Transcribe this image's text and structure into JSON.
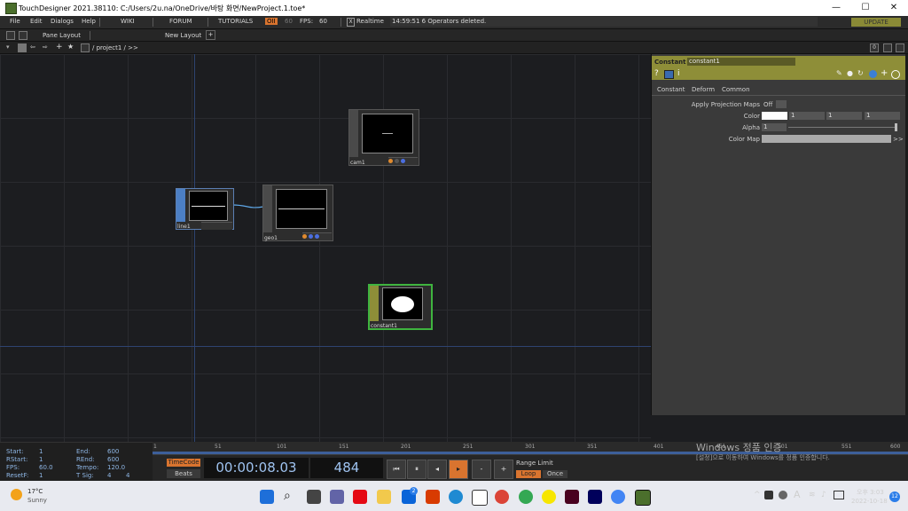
{
  "window": {
    "title": "TouchDesigner 2021.38110: C:/Users/2u.na/OneDrive/바탕 화면/NewProject.1.toe*",
    "minimize": "—",
    "maximize": "☐",
    "close": "✕"
  },
  "menu": {
    "items": [
      "File",
      "Edit",
      "Dialogs",
      "Help"
    ],
    "wiki": "WIKI",
    "forum": "FORUM",
    "tutorials": "TUTORIALS",
    "perf": "OII",
    "fps_target": "60",
    "fps_label": "FPS:",
    "fps_value": "60",
    "realtime_mark": "X",
    "realtime": "Realtime",
    "status": "14:59:51 6 Operators deleted.",
    "update": "UPDATE"
  },
  "panebar": {
    "pane_layout": "Pane Layout",
    "new_layout": "New Layout",
    "add": "+",
    "right_zero": "0"
  },
  "pathbar": {
    "path": "/ project1 / >>"
  },
  "nodes": {
    "cam1": "cam1",
    "line1": "line1",
    "geo1": "geo1",
    "constant1": "constant1"
  },
  "params": {
    "op_type": "Constant",
    "op_name": "constant1",
    "tabs": [
      "Constant",
      "Deform",
      "Common"
    ],
    "apply_label": "Apply Projection Maps",
    "apply_value": "Off",
    "color_label": "Color",
    "color_values": [
      "1",
      "1",
      "1"
    ],
    "alpha_label": "Alpha",
    "alpha_value": "1",
    "colormap_label": "Color Map",
    "colormap_more": ">>"
  },
  "timeinfo": {
    "start_label": "Start:",
    "start": "1",
    "rstart_label": "RStart:",
    "rstart": "1",
    "fps_label": "FPS:",
    "fps": "60.0",
    "resetf_label": "ResetF:",
    "resetf": "1",
    "end_label": "End:",
    "end": "600",
    "rend_label": "REnd:",
    "rend": "600",
    "tempo_label": "Tempo:",
    "tempo": "120.0",
    "tsig_label": "T Sig:",
    "tsig_a": "4",
    "tsig_b": "4"
  },
  "ruler": [
    "1",
    "51",
    "101",
    "151",
    "201",
    "251",
    "301",
    "351",
    "401",
    "451",
    "501",
    "551",
    "600"
  ],
  "transport": {
    "timecode_btn": "TimeCode",
    "beats_btn": "Beats",
    "timecode": "00:00:08.03",
    "frame": "484",
    "range_limit": "Range Limit",
    "loop": "Loop",
    "once": "Once",
    "minus": "-",
    "plus": "+"
  },
  "watermark": {
    "title": "Windows 정품 인증",
    "subtitle": "[설정]으로 이동하여 Windows를 정품 인증합니다."
  },
  "taskbar": {
    "temp": "17°C",
    "weather": "Sunny",
    "mail_badge": "2",
    "ime": "A",
    "ampm_time": "오후 3:03",
    "date": "2022-10-18",
    "notif": "12",
    "colors": {
      "windows": "#1e6fd9",
      "netflix": "#e50914",
      "office": "#d83b01",
      "indesign": "#49021f",
      "ae": "#00005b"
    }
  }
}
